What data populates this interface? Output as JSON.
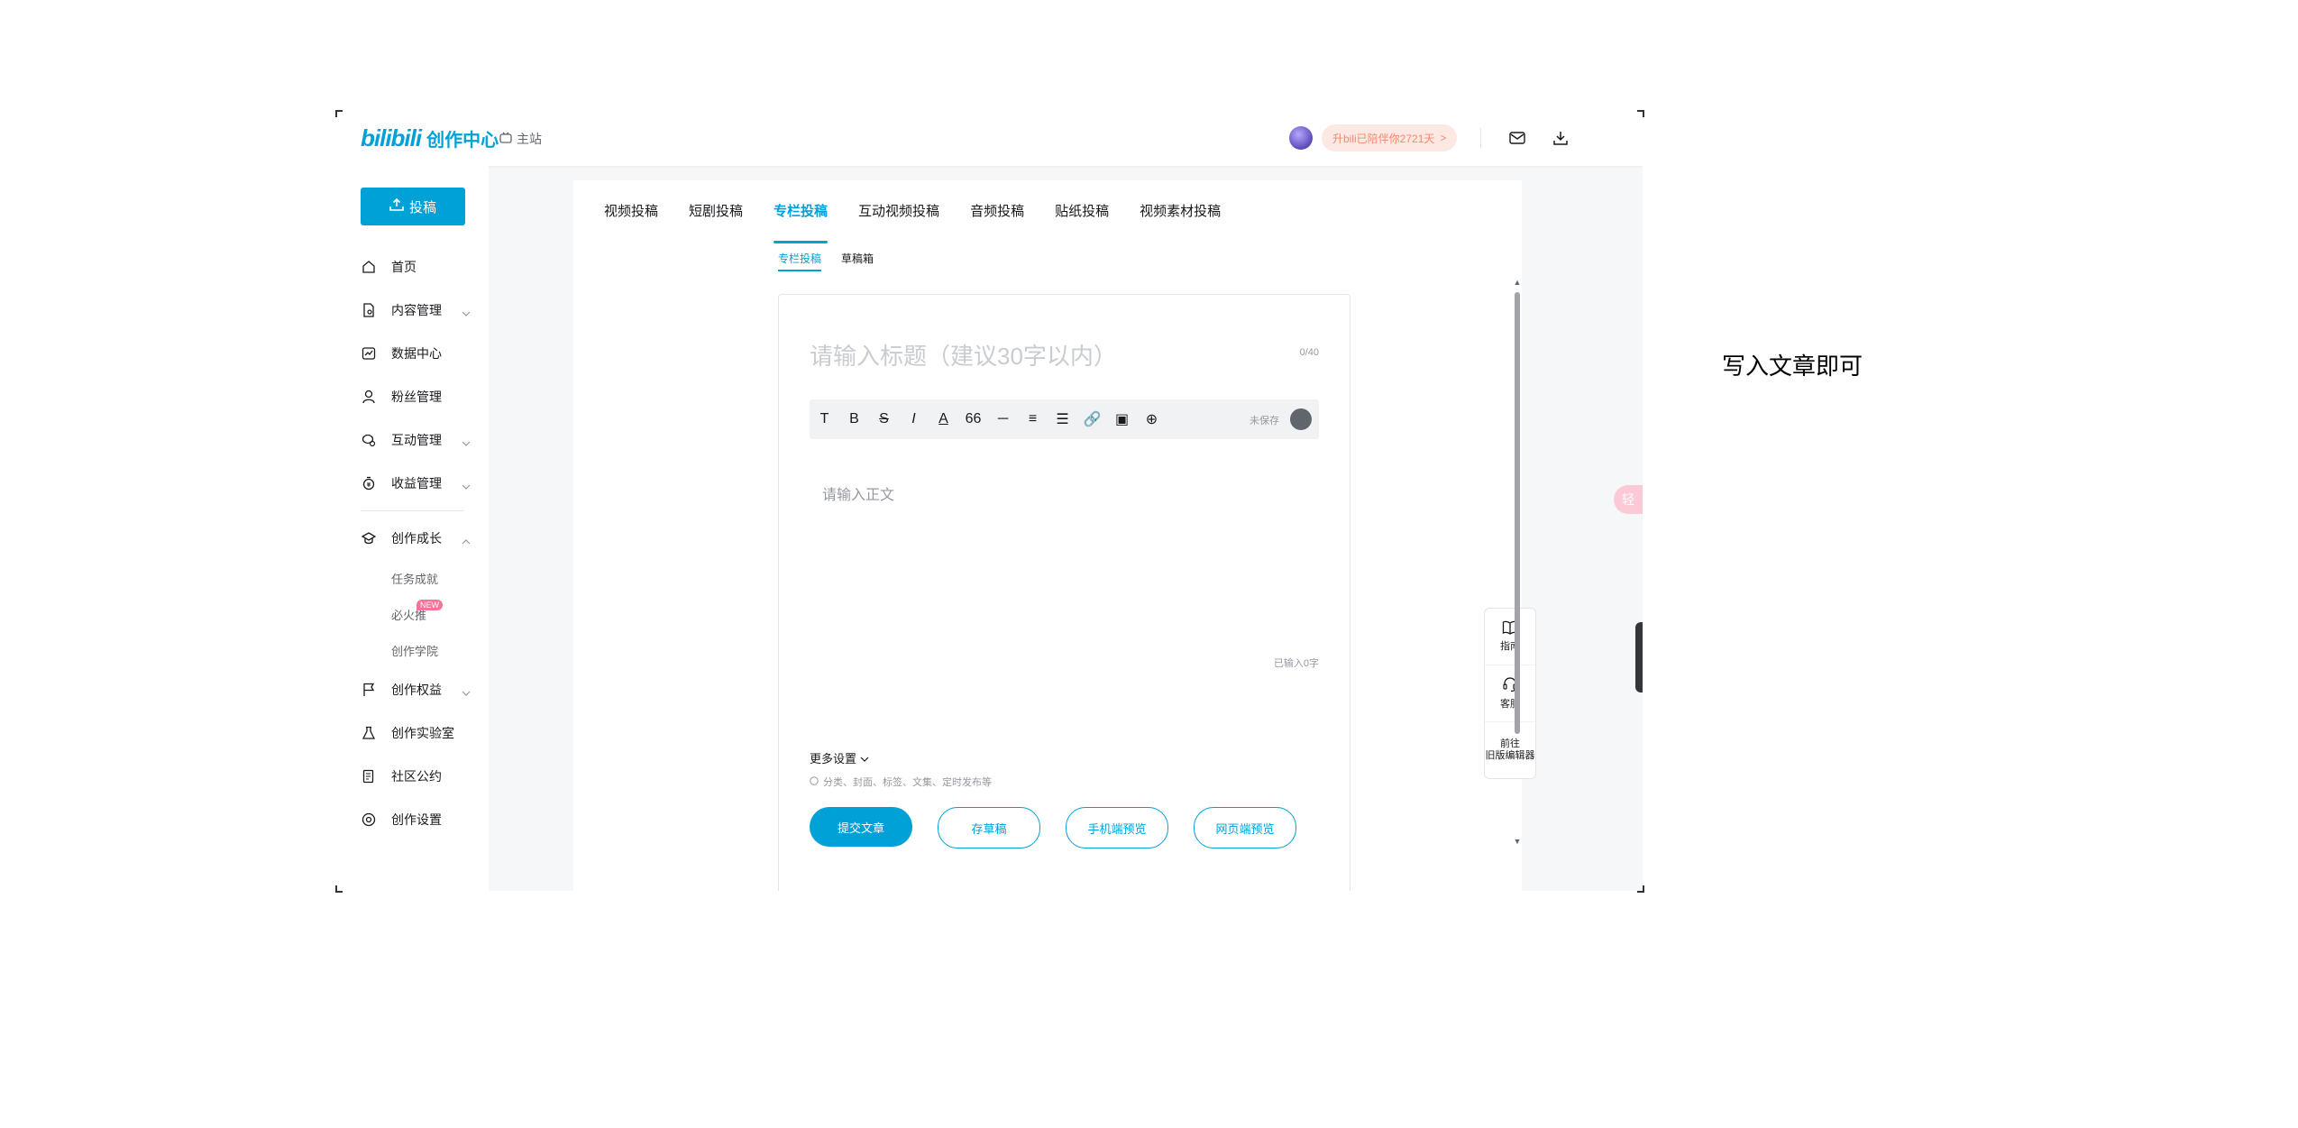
{
  "header": {
    "logo_brand": "bilibili",
    "logo_sub": "创作中心",
    "main_site": "主站",
    "banner_text": "升bili已陪伴你2721天",
    "banner_arrow": ">"
  },
  "sidebar": {
    "upload_label": "投稿",
    "items": [
      {
        "label": "首页",
        "icon": "home-icon"
      },
      {
        "label": "内容管理",
        "icon": "document-icon",
        "expand": "chevron-down"
      },
      {
        "label": "数据中心",
        "icon": "chart-icon"
      },
      {
        "label": "粉丝管理",
        "icon": "user-icon"
      },
      {
        "label": "互动管理",
        "icon": "chat-icon",
        "expand": "chevron-down"
      },
      {
        "label": "收益管理",
        "icon": "money-icon",
        "expand": "chevron-down"
      }
    ],
    "growth": {
      "label": "创作成长",
      "icon": "cap-icon",
      "expand": "chevron-up",
      "children": [
        {
          "label": "任务成就"
        },
        {
          "label": "必火推",
          "badge": "NEW"
        },
        {
          "label": "创作学院"
        }
      ]
    },
    "items2": [
      {
        "label": "创作权益",
        "icon": "flag-icon",
        "expand": "chevron-down"
      },
      {
        "label": "创作实验室",
        "icon": "flask-icon"
      },
      {
        "label": "社区公约",
        "icon": "rules-icon"
      },
      {
        "label": "创作设置",
        "icon": "settings-icon"
      }
    ]
  },
  "tabs": [
    "视频投稿",
    "短剧投稿",
    "专栏投稿",
    "互动视频投稿",
    "音频投稿",
    "贴纸投稿",
    "视频素材投稿"
  ],
  "active_tab": "专栏投稿",
  "subtabs": [
    "专栏投稿",
    "草稿箱"
  ],
  "active_subtab": "专栏投稿",
  "editor": {
    "title_placeholder": "请输入标题（建议30字以内）",
    "title_count": "0/40",
    "toolbar": [
      "T",
      "B",
      "S",
      "I",
      "A",
      "66",
      "─",
      "≡",
      "☰",
      "🔗",
      "▣",
      "⊕"
    ],
    "save_status": "未保存",
    "body_placeholder": "请输入正文",
    "word_count": "已输入0字",
    "more_settings": "更多设置",
    "settings_hint": "分类、封面、标签、文集、定时发布等",
    "submit": "提交文章",
    "save_draft": "存草稿",
    "mobile_preview": "手机端预览",
    "web_preview": "网页端预览"
  },
  "float_panel": {
    "guide": "指南",
    "service": "客服",
    "old_editor": "前往\n旧版编辑器"
  },
  "side_widget": "轻",
  "caption": "写入文章即可",
  "colors": {
    "accent": "#00a1d6",
    "pink": "#fb7299",
    "banner_bg": "#fde8e4"
  }
}
